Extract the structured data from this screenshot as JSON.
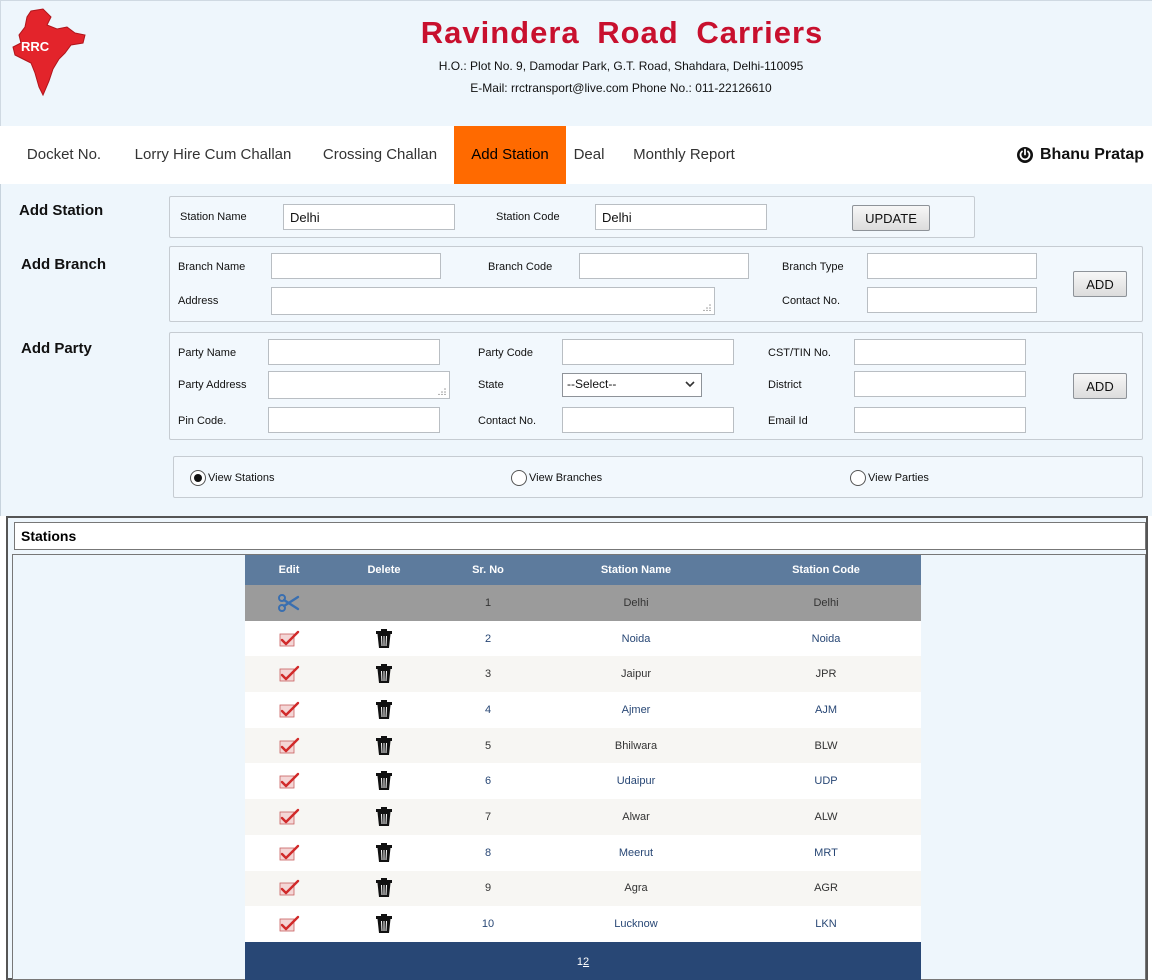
{
  "header": {
    "logo_text": "RRC",
    "company_name": "Ravindera  Road  Carriers",
    "address": "H.O.: Plot No. 9, Damodar Park, G.T. Road, Shahdara, Delhi-110095",
    "contact": "E-Mail: rrctransport@live.com Phone No.: 011-22126610"
  },
  "nav": {
    "items": [
      {
        "label": "Docket No."
      },
      {
        "label": "Lorry Hire Cum Challan"
      },
      {
        "label": "Crossing Challan"
      },
      {
        "label": "Add Station",
        "active": true
      },
      {
        "label": "Deal"
      },
      {
        "label": "Monthly Report"
      }
    ],
    "user": "Bhanu Pratap"
  },
  "add_station": {
    "title": "Add Station",
    "station_name_label": "Station Name",
    "station_name_value": "Delhi",
    "station_code_label": "Station Code",
    "station_code_value": "Delhi",
    "update_label": "UPDATE"
  },
  "add_branch": {
    "title": "Add Branch",
    "branch_name_label": "Branch Name",
    "branch_code_label": "Branch Code",
    "branch_type_label": "Branch Type",
    "address_label": "Address",
    "contact_label": "Contact No.",
    "add_label": "ADD"
  },
  "add_party": {
    "title": "Add Party",
    "party_name_label": "Party Name",
    "party_code_label": "Party Code",
    "cst_label": "CST/TIN No.",
    "party_address_label": "Party Address",
    "state_label": "State",
    "state_selected": "--Select--",
    "district_label": "District",
    "pin_label": "Pin Code.",
    "contact_label": "Contact No.",
    "email_label": "Email Id",
    "add_label": "ADD"
  },
  "view_options": {
    "stations": "View Stations",
    "branches": "View Branches",
    "parties": "View Parties",
    "selected": "stations"
  },
  "grid": {
    "title": "Stations",
    "columns": [
      "Edit",
      "Delete",
      "Sr. No",
      "Station Name",
      "Station Code"
    ],
    "rows": [
      {
        "sr": "1",
        "name": "Delhi",
        "code": "Delhi",
        "selected": true
      },
      {
        "sr": "2",
        "name": "Noida",
        "code": "Noida"
      },
      {
        "sr": "3",
        "name": "Jaipur",
        "code": "JPR"
      },
      {
        "sr": "4",
        "name": "Ajmer",
        "code": "AJM"
      },
      {
        "sr": "5",
        "name": "Bhilwara",
        "code": "BLW"
      },
      {
        "sr": "6",
        "name": "Udaipur",
        "code": "UDP"
      },
      {
        "sr": "7",
        "name": "Alwar",
        "code": "ALW"
      },
      {
        "sr": "8",
        "name": "Meerut",
        "code": "MRT"
      },
      {
        "sr": "9",
        "name": "Agra",
        "code": "AGR"
      },
      {
        "sr": "10",
        "name": "Lucknow",
        "code": "LKN"
      }
    ],
    "pager": {
      "current": "1",
      "next": "2"
    }
  },
  "colors": {
    "brand_red": "#c8102e",
    "nav_active": "#ff6a00",
    "grid_header": "#5d7b9d",
    "grid_pager": "#284775",
    "grid_selected": "#9b9b9b"
  },
  "icons": {
    "edit": "pencil-check-icon",
    "delete": "trash-icon",
    "cancel": "scissors-icon",
    "user": "power-icon"
  }
}
